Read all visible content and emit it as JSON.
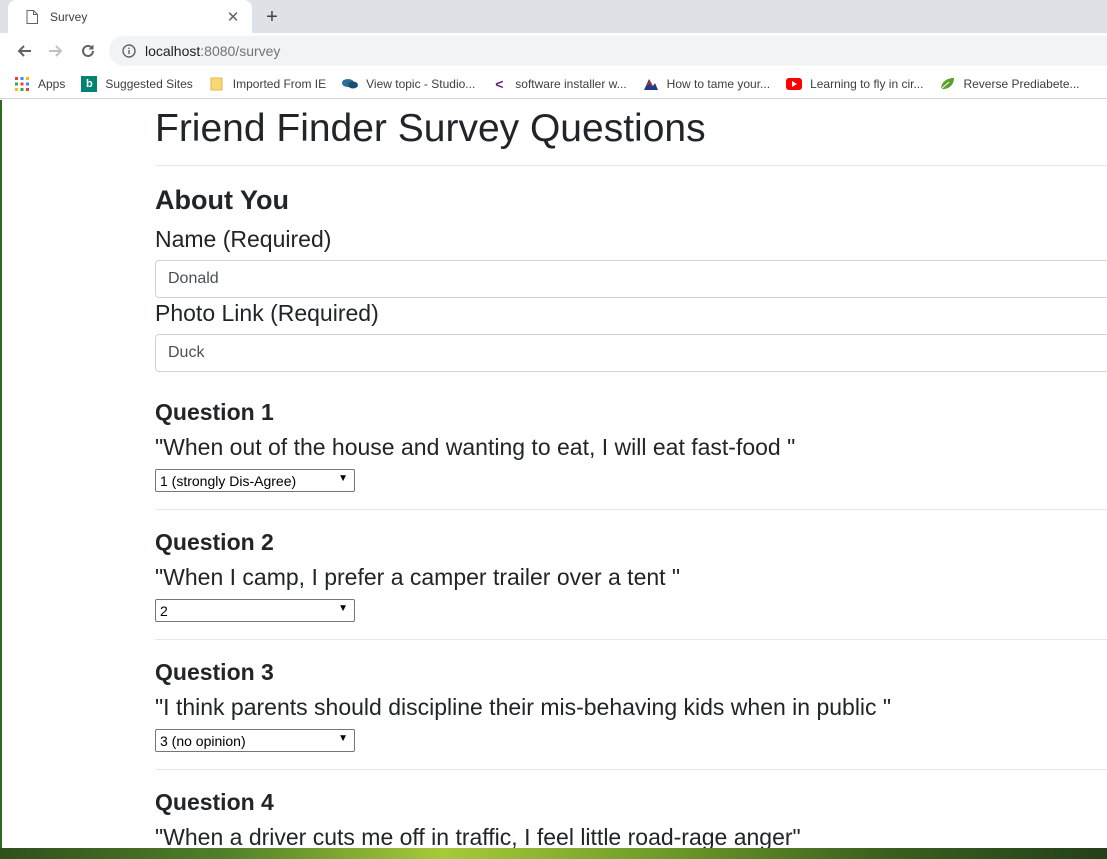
{
  "browser": {
    "tab_title": "Survey",
    "url_host": "localhost",
    "url_path": ":8080/survey",
    "bookmarks": [
      {
        "label": "Apps",
        "icon": "apps-grid-icon"
      },
      {
        "label": "Suggested Sites",
        "icon": "bing-icon"
      },
      {
        "label": "Imported From IE",
        "icon": "folder-icon"
      },
      {
        "label": "View topic - Studio...",
        "icon": "forum-icon"
      },
      {
        "label": "software installer w...",
        "icon": "vs-icon"
      },
      {
        "label": "How to tame your...",
        "icon": "site-icon"
      },
      {
        "label": "Learning to fly in cir...",
        "icon": "youtube-icon"
      },
      {
        "label": "Reverse Prediabete...",
        "icon": "leaf-icon"
      }
    ]
  },
  "page": {
    "title": "Friend Finder Survey Questions",
    "about": {
      "heading": "About You",
      "name_label": "Name (Required)",
      "name_value": "Donald",
      "photo_label": "Photo Link (Required)",
      "photo_value": "Duck"
    },
    "questions": [
      {
        "heading": "Question 1",
        "text": "\"When out of the house and wanting to eat, I will eat fast-food \"",
        "selected": "1 (strongly Dis-Agree)"
      },
      {
        "heading": "Question 2",
        "text": "\"When I camp, I prefer a camper trailer over a tent \"",
        "selected": "2"
      },
      {
        "heading": "Question 3",
        "text": "\"I think parents should discipline their mis-behaving kids when in public \"",
        "selected": "3 (no opinion)"
      },
      {
        "heading": "Question 4",
        "text": "\"When a driver cuts me off in traffic, I feel little road-rage anger\""
      }
    ]
  },
  "colors": {
    "text": "#212529",
    "tabstrip": "#dee1e6",
    "omnibox": "#f1f3f4",
    "rule": "#e6e6e6"
  }
}
